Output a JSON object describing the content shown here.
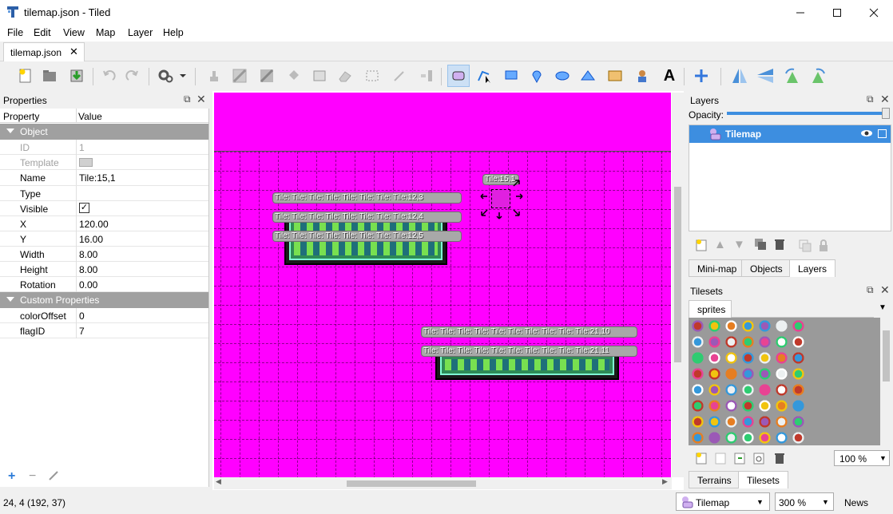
{
  "window": {
    "title": "tilemap.json - Tiled",
    "min": "—",
    "max": "☐",
    "close": "✕"
  },
  "menu": [
    "File",
    "Edit",
    "View",
    "Map",
    "Layer",
    "Help"
  ],
  "document_tab": {
    "label": "tilemap.json",
    "close": "✕"
  },
  "properties": {
    "title": "Properties",
    "col_property": "Property",
    "col_value": "Value",
    "group_object": "Object",
    "rows": [
      {
        "key": "ID",
        "value": "1",
        "disabled": true
      },
      {
        "key": "Template",
        "value": "",
        "disabled": true
      },
      {
        "key": "Name",
        "value": "Tile:15,1"
      },
      {
        "key": "Type",
        "value": ""
      },
      {
        "key": "Visible",
        "value": "✓"
      },
      {
        "key": "X",
        "value": "120.00"
      },
      {
        "key": "Y",
        "value": "16.00"
      },
      {
        "key": "Width",
        "value": "8.00"
      },
      {
        "key": "Height",
        "value": "8.00"
      },
      {
        "key": "Rotation",
        "value": "0.00"
      }
    ],
    "group_custom": "Custom Properties",
    "custom_rows": [
      {
        "key": "colorOffset",
        "value": "0"
      },
      {
        "key": "flagID",
        "value": "7"
      }
    ]
  },
  "canvas": {
    "background": "#ff00ff",
    "selected_label": "Tile:15,1",
    "rows_a": [
      "Tile: Tile: Tile: Tile: Tile: Tile: Tile: Tile:12,3",
      "Tile: Tile: Tile: Tile: Tile: Tile: Tile: Tile:12,4",
      "Tile: Tile: Tile: Tile: Tile: Tile: Tile: Tile:12,5"
    ],
    "rows_b": [
      "Tile: Tile: Tile: Tile: Tile: Tile: Tile: Tile: Tile: Tile:21,10",
      "Tile: Tile: Tile: Tile: Tile: Tile: Tile: Tile: Tile: Tile:21,11"
    ]
  },
  "layers": {
    "title": "Layers",
    "opacity_label": "Opacity:",
    "opacity": 1.0,
    "items": [
      {
        "name": "Tilemap",
        "visible": true,
        "selected": true
      }
    ],
    "tabs": [
      "Mini-map",
      "Objects",
      "Layers"
    ],
    "active_tab": "Layers"
  },
  "tilesets": {
    "title": "Tilesets",
    "tab": "sprites",
    "zoom": "100 %",
    "tabs": [
      "Terrains",
      "Tilesets"
    ],
    "active_tab": "Tilesets"
  },
  "status": {
    "coords": "24, 4 (192, 37)",
    "layer": "Tilemap",
    "zoom": "300 %",
    "news": "News"
  },
  "colors": {
    "accent": "#3d8ee0",
    "magenta": "#ff00ff",
    "group_bg": "#a0a0a0"
  }
}
